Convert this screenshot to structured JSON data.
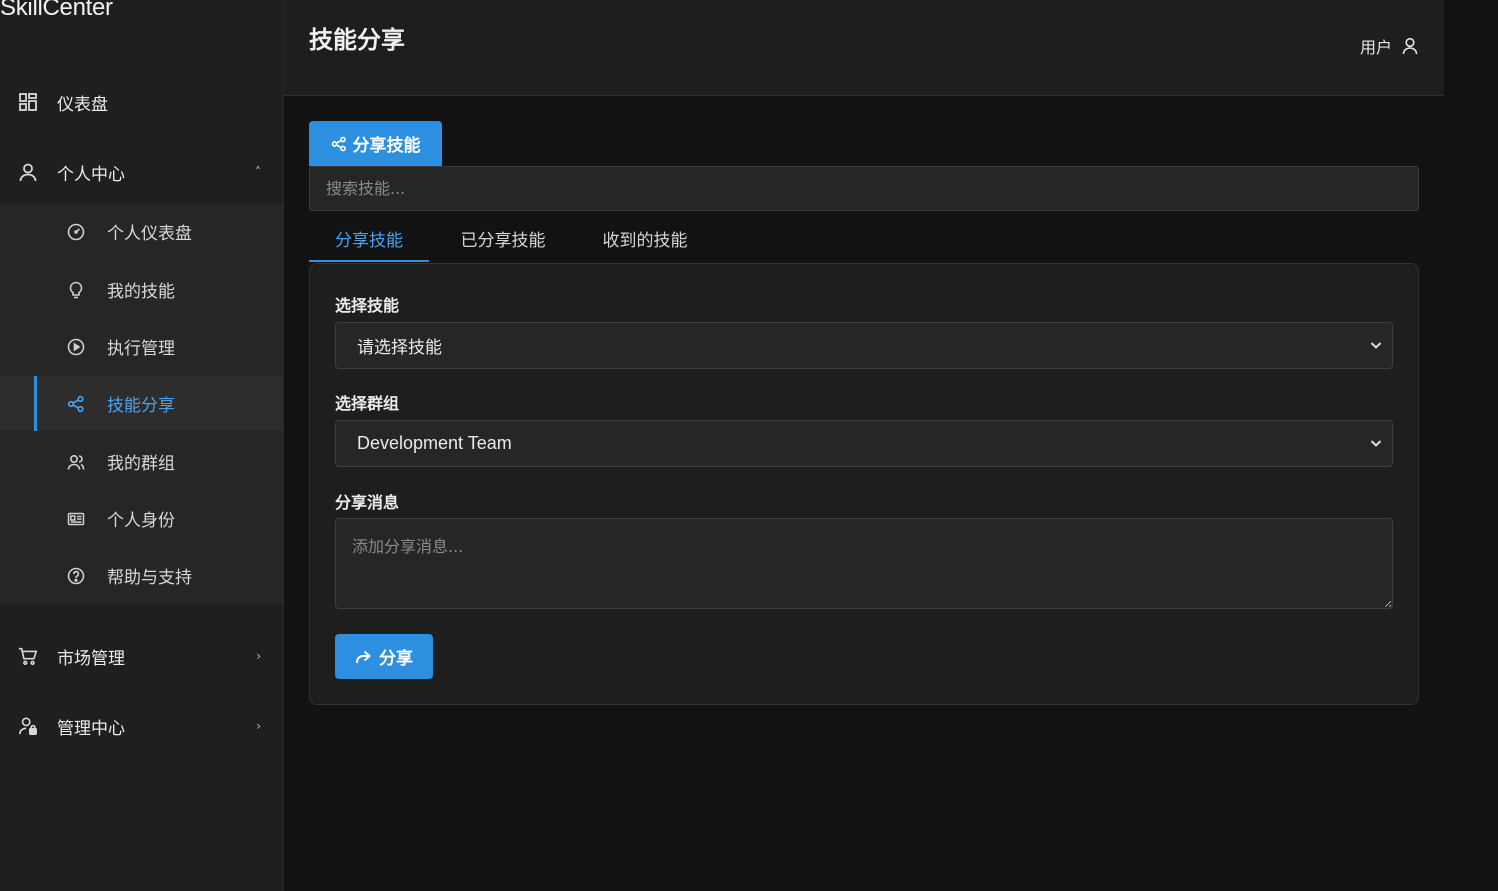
{
  "brand": "SkillCenter",
  "sidebar": {
    "dashboard": "仪表盘",
    "personal_center": "个人中心",
    "sub_items": [
      {
        "label": "个人仪表盘",
        "icon": "gauge-icon"
      },
      {
        "label": "我的技能",
        "icon": "lightbulb-icon"
      },
      {
        "label": "执行管理",
        "icon": "play-circle-icon"
      },
      {
        "label": "技能分享",
        "icon": "share-icon"
      },
      {
        "label": "我的群组",
        "icon": "users-icon"
      },
      {
        "label": "个人身份",
        "icon": "id-card-icon"
      },
      {
        "label": "帮助与支持",
        "icon": "help-circle-icon"
      }
    ],
    "market": "市场管理",
    "admin": "管理中心"
  },
  "header": {
    "title": "技能分享",
    "user_label": "用户"
  },
  "main": {
    "share_button": "分享技能",
    "search_placeholder": "搜索技能...",
    "tabs": [
      "分享技能",
      "已分享技能",
      "收到的技能"
    ],
    "form": {
      "skill_label": "选择技能",
      "skill_value": "请选择技能",
      "group_label": "选择群组",
      "group_value": "Development Team",
      "message_label": "分享消息",
      "message_placeholder": "添加分享消息...",
      "submit": "分享"
    }
  },
  "colors": {
    "accent": "#2d8fe0",
    "background": "#121212",
    "sidebar": "#1f1f1f"
  }
}
